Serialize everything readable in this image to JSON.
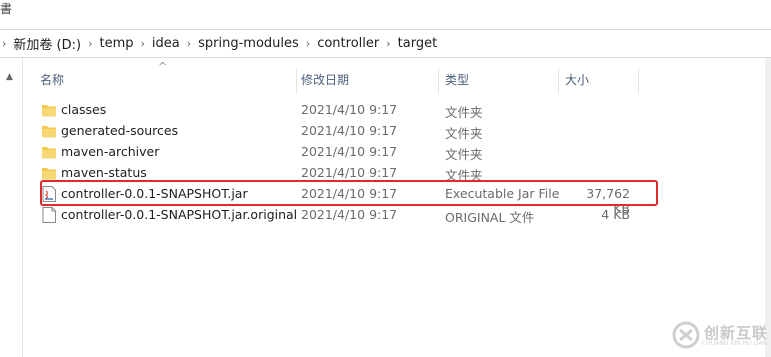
{
  "window": {
    "top_glyph": "書"
  },
  "address_bar": {
    "crumbs": [
      "新加卷 (D:)",
      "temp",
      "idea",
      "spring-modules",
      "controller",
      "target"
    ]
  },
  "columns": {
    "name": "名称",
    "date": "修改日期",
    "type": "类型",
    "size": "大小"
  },
  "files": [
    {
      "name": "classes",
      "date": "2021/4/10 9:17",
      "type": "文件夹",
      "size": "",
      "icon": "folder-icon"
    },
    {
      "name": "generated-sources",
      "date": "2021/4/10 9:17",
      "type": "文件夹",
      "size": "",
      "icon": "folder-icon"
    },
    {
      "name": "maven-archiver",
      "date": "2021/4/10 9:17",
      "type": "文件夹",
      "size": "",
      "icon": "folder-icon"
    },
    {
      "name": "maven-status",
      "date": "2021/4/10 9:17",
      "type": "文件夹",
      "size": "",
      "icon": "folder-icon"
    },
    {
      "name": "controller-0.0.1-SNAPSHOT.jar",
      "date": "2021/4/10 9:17",
      "type": "Executable Jar File",
      "size": "37,762 KB",
      "icon": "java-jar-icon"
    },
    {
      "name": "controller-0.0.1-SNAPSHOT.jar.original",
      "date": "2021/4/10 9:17",
      "type": "ORIGINAL 文件",
      "size": "4 KB",
      "icon": "file-icon"
    }
  ],
  "watermark": {
    "text": "创新互联",
    "sub": "CHUANG XIN HU LIAN"
  },
  "colors": {
    "highlight": "#e12b2b",
    "folder": "#f4c84e",
    "header_text": "#4c607a"
  }
}
